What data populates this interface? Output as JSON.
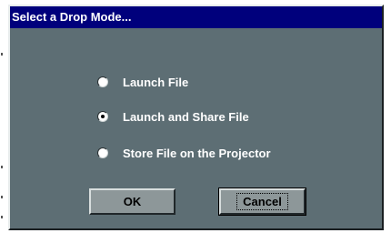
{
  "dialog": {
    "title": "Select a Drop Mode...",
    "options": [
      {
        "label": "Launch File",
        "selected": false
      },
      {
        "label": "Launch and Share File",
        "selected": true
      },
      {
        "label": "Store File on the Projector",
        "selected": false
      }
    ],
    "buttons": {
      "ok_label": "OK",
      "cancel_label": "Cancel"
    }
  },
  "colors": {
    "title_bar": "#00007c",
    "dialog_body": "#5d6e74",
    "button_face": "#8d9799"
  }
}
